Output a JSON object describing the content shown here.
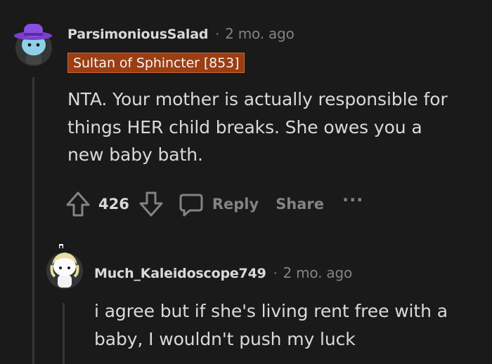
{
  "comment": {
    "username": "ParsimoniousSalad",
    "separator": "·",
    "time": "2 mo. ago",
    "flair": "Sultan of Sphincter [853]",
    "body_lines": [
      "NTA. Your mother is actually responsible for",
      "things HER child breaks. She owes you a",
      "new baby bath."
    ],
    "score": "426",
    "reply_label": "Reply",
    "share_label": "Share",
    "more_label": "···"
  },
  "reply": {
    "username": "Much_Kaleidoscope749",
    "separator": "·",
    "time": "2 mo. ago",
    "body_lines": [
      "i agree but if she's living rent free with a",
      "baby, I wouldn't push my luck"
    ]
  },
  "colors": {
    "background": "#1a1a1b",
    "text": "#d7dadc",
    "muted": "#818384",
    "flair_bg": "#9c3d12",
    "thread_line": "#343536"
  }
}
